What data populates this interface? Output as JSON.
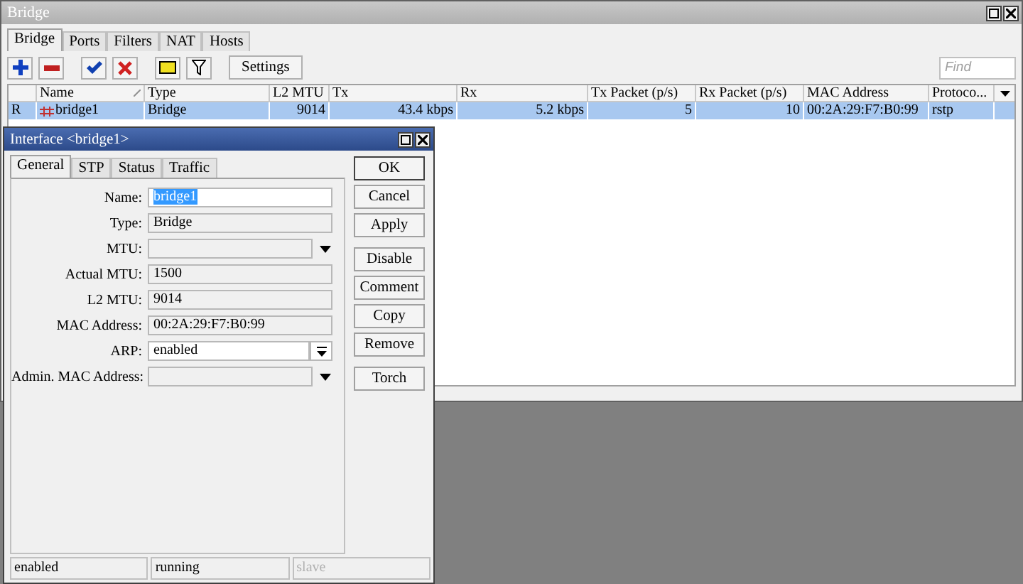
{
  "window": {
    "title": "Bridge"
  },
  "tabs": [
    {
      "label": "Bridge",
      "selected": true
    },
    {
      "label": "Ports",
      "selected": false
    },
    {
      "label": "Filters",
      "selected": false
    },
    {
      "label": "NAT",
      "selected": false
    },
    {
      "label": "Hosts",
      "selected": false
    }
  ],
  "toolbar": {
    "settings_label": "Settings",
    "find_placeholder": "Find"
  },
  "table": {
    "columns": [
      {
        "sorted": false
      },
      {
        "label": "Name",
        "sorted": true
      },
      {
        "label": "Type",
        "sorted": false
      },
      {
        "label": "L2 MTU",
        "sorted": false
      },
      {
        "label": "Tx",
        "sorted": false
      },
      {
        "label": "Rx",
        "sorted": false
      },
      {
        "label": "Tx Packet (p/s)",
        "sorted": false
      },
      {
        "label": "Rx Packet (p/s)",
        "sorted": false
      },
      {
        "label": "MAC Address",
        "sorted": false
      },
      {
        "label": "Protoco...",
        "sorted": false
      }
    ],
    "rows": [
      {
        "selected": true,
        "cells": [
          "R",
          "bridge1",
          "Bridge",
          "9014",
          "43.4 kbps",
          "5.2 kbps",
          "5",
          "10",
          "00:2A:29:F7:B0:99",
          "rstp"
        ]
      }
    ]
  },
  "dialog": {
    "title": "Interface <bridge1>",
    "tabs": [
      {
        "label": "General",
        "selected": true
      },
      {
        "label": "STP",
        "selected": false
      },
      {
        "label": "Status",
        "selected": false
      },
      {
        "label": "Traffic",
        "selected": false
      }
    ],
    "fields": [
      {
        "label": "Name:",
        "value": "bridge1",
        "kind": "editable",
        "value_selected": true
      },
      {
        "label": "Type:",
        "value": "Bridge",
        "kind": "readonly",
        "value_selected": false
      },
      {
        "label": "MTU:",
        "kind": "dropdown",
        "value_selected": false
      },
      {
        "label": "Actual MTU:",
        "value": "1500",
        "kind": "readonly",
        "value_selected": false
      },
      {
        "label": "L2 MTU:",
        "value": "9014",
        "kind": "readonly",
        "value_selected": false
      },
      {
        "label": "MAC Address:",
        "value": "00:2A:29:F7:B0:99",
        "kind": "readonly",
        "value_selected": false
      },
      {
        "label": "ARP:",
        "value": "enabled",
        "kind": "select",
        "value_selected": false
      },
      {
        "label": "Admin. MAC Address:",
        "kind": "dropdown",
        "value_selected": false
      }
    ],
    "button_groups": [
      [
        "OK",
        "Cancel",
        "Apply"
      ],
      [
        "Disable",
        "Comment",
        "Copy",
        "Remove"
      ],
      [
        "Torch"
      ]
    ],
    "status_bar": [
      {
        "text": "enabled",
        "disabled": false
      },
      {
        "text": "running",
        "disabled": false
      },
      {
        "text": "slave",
        "disabled": true
      }
    ]
  }
}
